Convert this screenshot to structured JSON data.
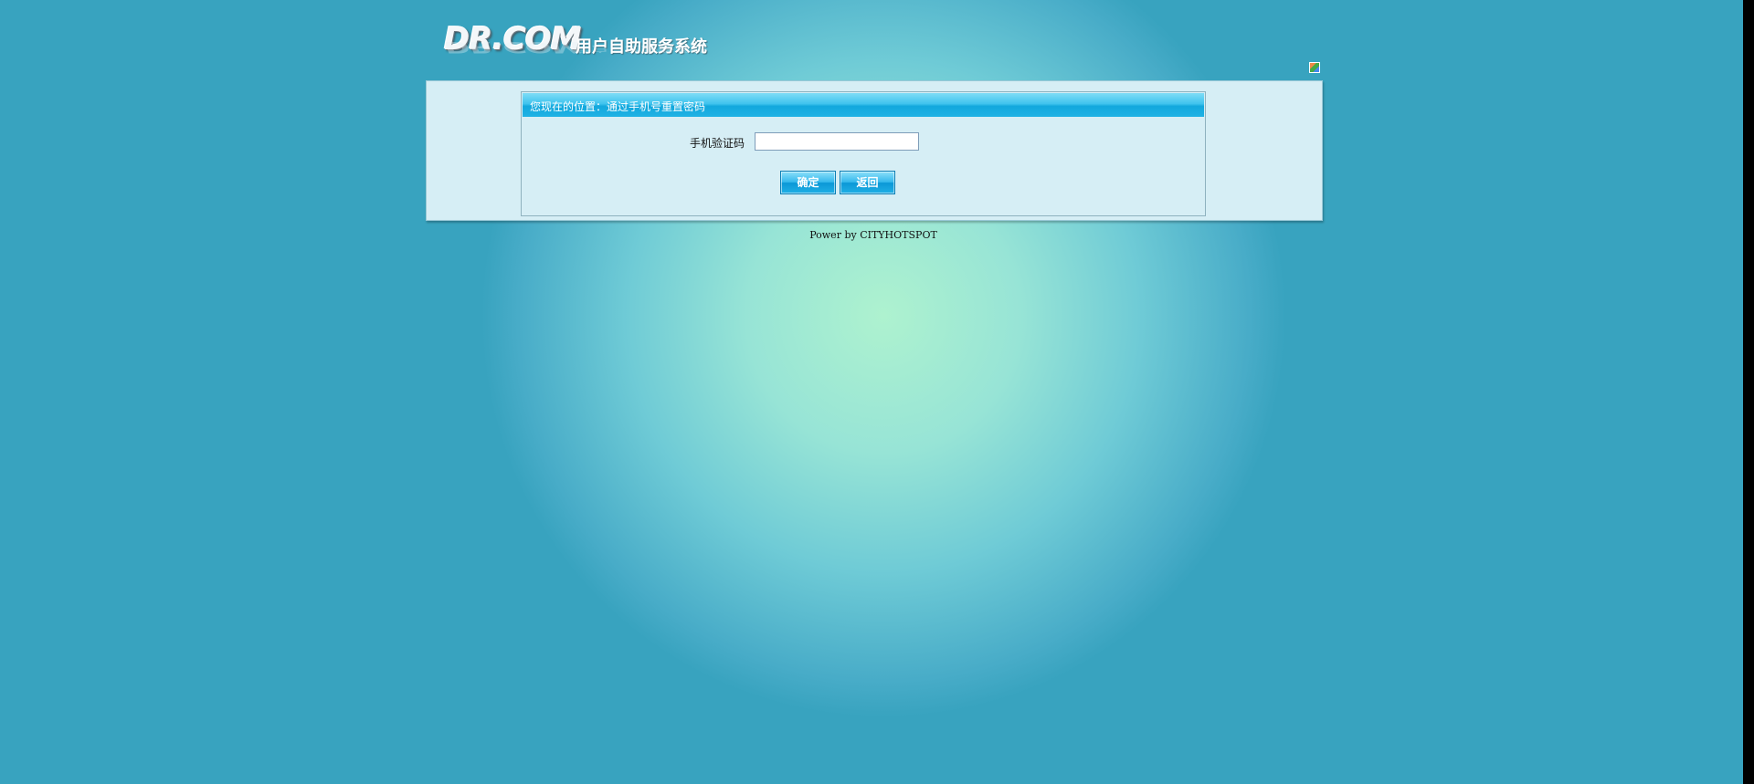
{
  "header": {
    "logo_text": "DR.COM",
    "logo_reg": "®",
    "system_title": "用户自助服务系统",
    "lang_icon": "language-flag-icon"
  },
  "panel": {
    "breadcrumb": "您现在的位置：通过手机号重置密码",
    "form": {
      "code_label": "手机验证码",
      "code_value": "",
      "code_placeholder": ""
    },
    "buttons": {
      "confirm": "确定",
      "back": "返回"
    }
  },
  "footer": {
    "text": "Power by CITYHOTSPOT"
  },
  "colors": {
    "background": "#38a3bf",
    "glow_center": "#aef2cf",
    "panel": "#d6eef5",
    "header_bar": "#40c4ee"
  }
}
